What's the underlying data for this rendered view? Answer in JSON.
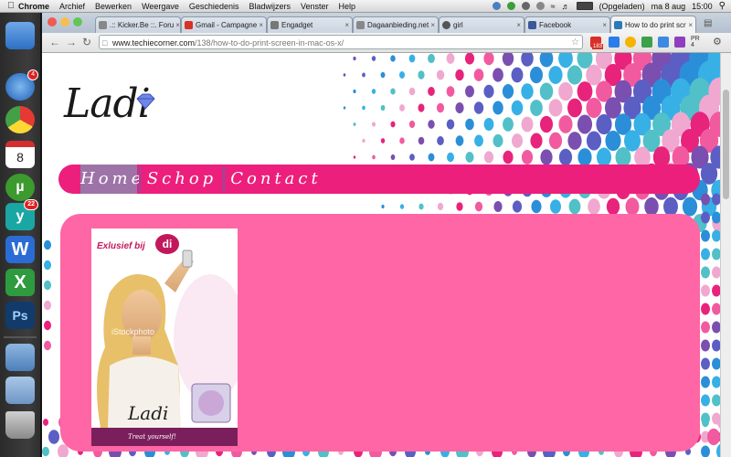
{
  "menubar": {
    "app": "Chrome",
    "items": [
      "Archief",
      "Bewerken",
      "Weergave",
      "Geschiedenis",
      "Bladwijzers",
      "Venster",
      "Help"
    ],
    "battery": "(Opgeladen)",
    "date": "ma 8 aug",
    "time": "15:00"
  },
  "dock": {
    "badges": [
      "4",
      "22"
    ],
    "calendar_day": "8"
  },
  "browser": {
    "tabs": [
      {
        "label": ".:: Kicker.Be ::. Foru"
      },
      {
        "label": "Gmail - Campagne"
      },
      {
        "label": "Engadget"
      },
      {
        "label": "Dagaanbieding.net"
      },
      {
        "label": "girl"
      },
      {
        "label": "Facebook"
      },
      {
        "label": "How to do print scr"
      }
    ],
    "url_prefix": "www.techiecorner.com",
    "url_path": "/138/how-to-do-print-screen-in-mac-os-x/",
    "gmail_count": "183",
    "pr_badge": "PR 4"
  },
  "site": {
    "logo": "Ladi",
    "nav": [
      "Home",
      "Schop",
      "Contact"
    ],
    "card": {
      "headline": "Exlusief bij",
      "badge": "di",
      "watermark": "iStockphoto",
      "brand": "Ladi",
      "tagline": "Treat yourself!"
    }
  },
  "colors": {
    "nav_pink": "#ec1f7c",
    "content_pink": "#fe66a5",
    "nav_active": "#9e73a8"
  }
}
